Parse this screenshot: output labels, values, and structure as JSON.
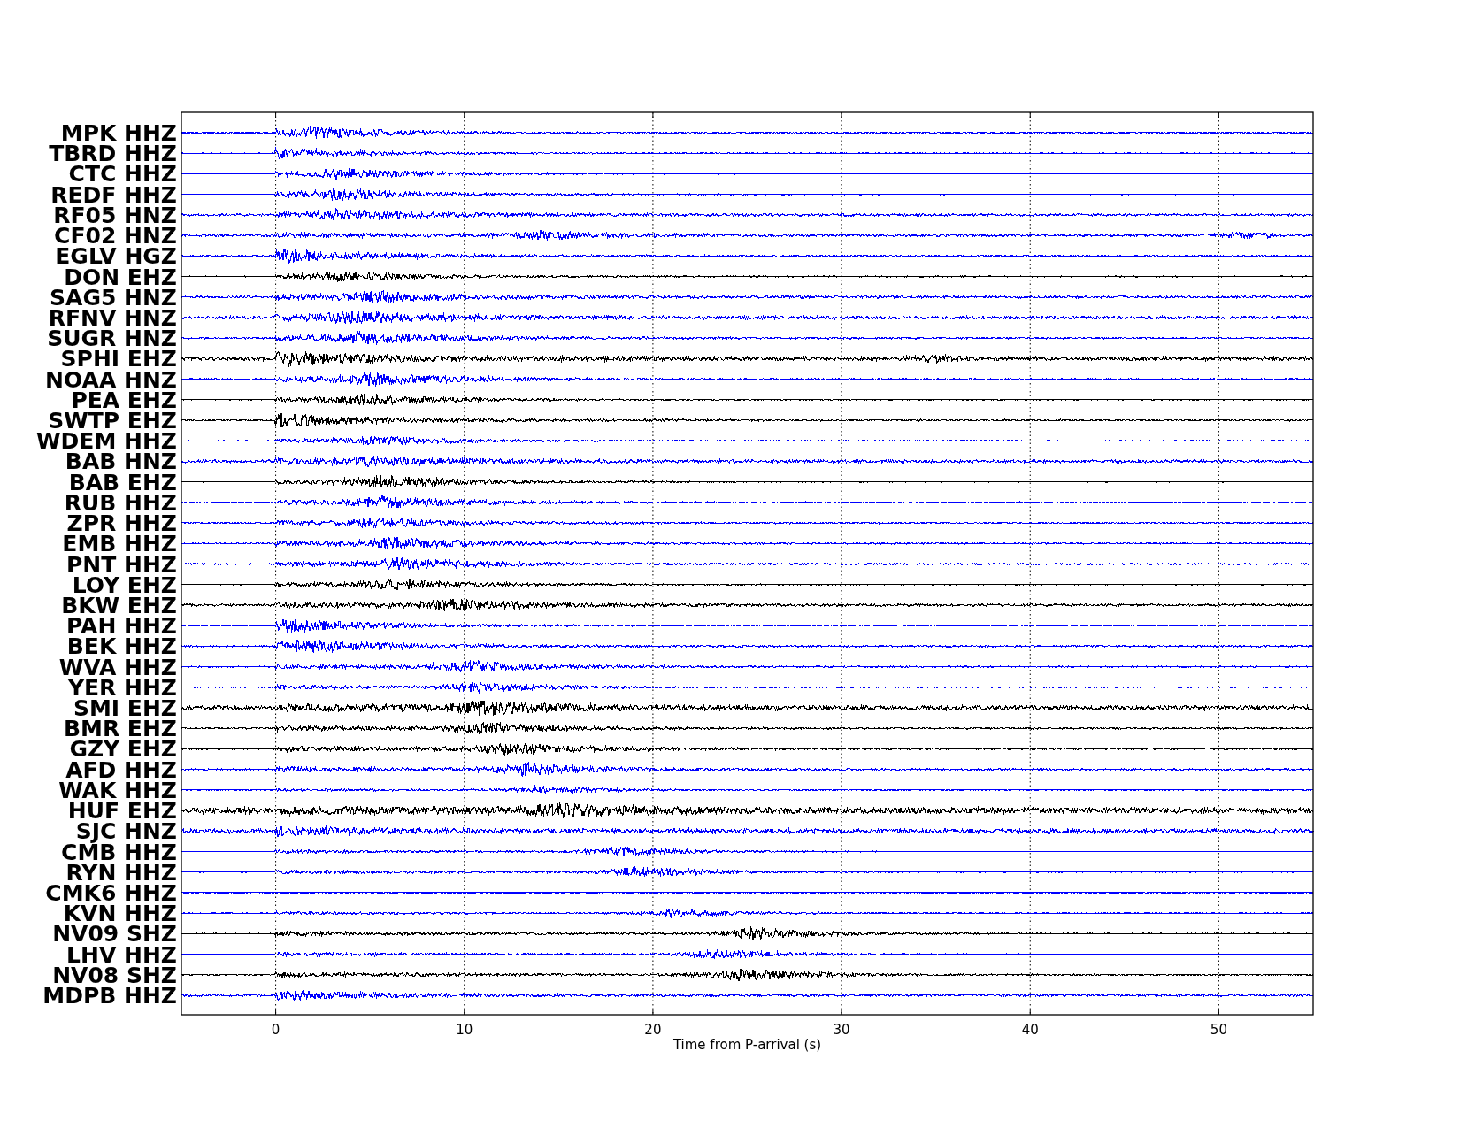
{
  "plot": {
    "xlabel": "Time from P-arrival (s)",
    "xticks": [
      "0",
      "10",
      "20",
      "30",
      "40",
      "50"
    ],
    "traces": [
      {
        "label": "MPK HHZ",
        "color": "#0000ff"
      },
      {
        "label": "TBRD HHZ",
        "color": "#0000ff"
      },
      {
        "label": "CTC HHZ",
        "color": "#0000ff"
      },
      {
        "label": "REDF HHZ",
        "color": "#0000ff"
      },
      {
        "label": "RF05 HNZ",
        "color": "#0000ff"
      },
      {
        "label": "CF02 HNZ",
        "color": "#0000ff"
      },
      {
        "label": "EGLV HGZ",
        "color": "#0000ff"
      },
      {
        "label": "DON EHZ",
        "color": "#000000"
      },
      {
        "label": "SAG5 HNZ",
        "color": "#0000ff"
      },
      {
        "label": "RFNV HNZ",
        "color": "#0000ff"
      },
      {
        "label": "SUGR HNZ",
        "color": "#0000ff"
      },
      {
        "label": "SPHI EHZ",
        "color": "#000000"
      },
      {
        "label": "NOAA HNZ",
        "color": "#0000ff"
      },
      {
        "label": "PEA EHZ",
        "color": "#000000"
      },
      {
        "label": "SWTP EHZ",
        "color": "#000000"
      },
      {
        "label": "WDEM HHZ",
        "color": "#0000ff"
      },
      {
        "label": "BAB HNZ",
        "color": "#0000ff"
      },
      {
        "label": "BAB EHZ",
        "color": "#000000"
      },
      {
        "label": "RUB HHZ",
        "color": "#0000ff"
      },
      {
        "label": "ZPR HHZ",
        "color": "#0000ff"
      },
      {
        "label": "EMB HHZ",
        "color": "#0000ff"
      },
      {
        "label": "PNT HHZ",
        "color": "#0000ff"
      },
      {
        "label": "LOY EHZ",
        "color": "#000000"
      },
      {
        "label": "BKW EHZ",
        "color": "#000000"
      },
      {
        "label": "PAH HHZ",
        "color": "#0000ff"
      },
      {
        "label": "BEK HHZ",
        "color": "#0000ff"
      },
      {
        "label": "WVA HHZ",
        "color": "#0000ff"
      },
      {
        "label": "YER HHZ",
        "color": "#0000ff"
      },
      {
        "label": "SMI EHZ",
        "color": "#000000"
      },
      {
        "label": "BMR EHZ",
        "color": "#000000"
      },
      {
        "label": "GZY EHZ",
        "color": "#000000"
      },
      {
        "label": "AFD HHZ",
        "color": "#0000ff"
      },
      {
        "label": "WAK HHZ",
        "color": "#0000ff"
      },
      {
        "label": "HUF EHZ",
        "color": "#000000"
      },
      {
        "label": "SJC HNZ",
        "color": "#0000ff"
      },
      {
        "label": "CMB HHZ",
        "color": "#0000ff"
      },
      {
        "label": "RYN HHZ",
        "color": "#0000ff"
      },
      {
        "label": "CMK6 HHZ",
        "color": "#0000ff"
      },
      {
        "label": "KVN HHZ",
        "color": "#0000ff"
      },
      {
        "label": "NV09 SHZ",
        "color": "#000000"
      },
      {
        "label": "LHV HHZ",
        "color": "#0000ff"
      },
      {
        "label": "NV08 SHZ",
        "color": "#000000"
      },
      {
        "label": "MDPB HHZ",
        "color": "#0000ff"
      }
    ]
  }
}
